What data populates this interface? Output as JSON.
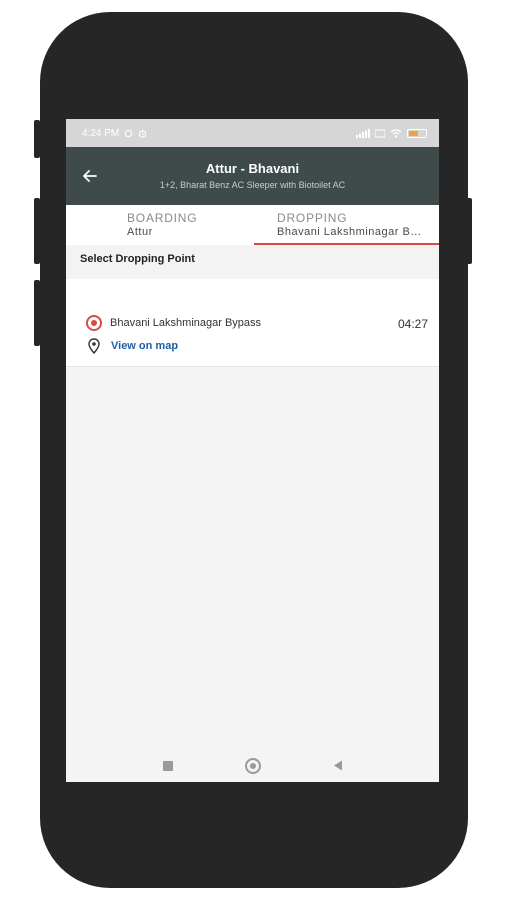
{
  "status_bar": {
    "time": "4:24 PM",
    "battery_percent": 55
  },
  "app_bar": {
    "title": "Attur - Bhavani",
    "subtitle": "1+2, Bharat Benz AC Sleeper with Biotoilet AC"
  },
  "tabs": [
    {
      "label": "BOARDING",
      "value": "Attur",
      "selected": false
    },
    {
      "label": "DROPPING",
      "value": "Bhavani Lakshminagar Bypass",
      "selected": true
    }
  ],
  "section": {
    "title": "Select Dropping Point"
  },
  "dropping_points": [
    {
      "name": "Bhavani Lakshminagar Bypass",
      "time": "04:27",
      "map_link": "View on map",
      "selected": true
    }
  ],
  "colors": {
    "app_bar_bg": "#3f4a4b",
    "accent": "#d84a4a",
    "link": "#1f5fa6"
  },
  "icons": {
    "back": "back-arrow-icon",
    "radio": "radio-selected-icon",
    "pin": "map-pin-icon",
    "recent": "recent-apps-icon",
    "home": "home-icon",
    "nav_back": "nav-back-icon"
  }
}
